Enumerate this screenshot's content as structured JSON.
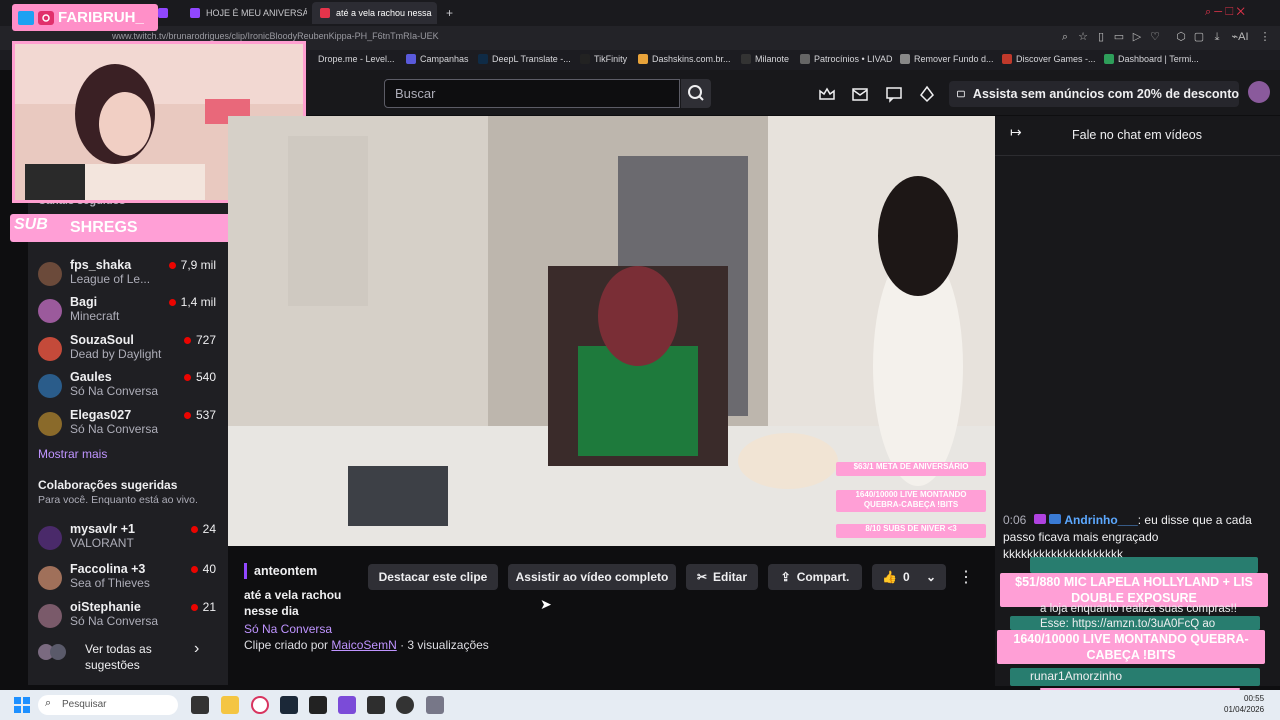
{
  "browser": {
    "tabs": [
      {
        "label": "",
        "icon": "twitch-tab-icon"
      },
      {
        "label": "HOJE É MEU ANIVERSÁRIO",
        "icon": "twitch-tab-icon"
      },
      {
        "label": "até a vela rachou nessa",
        "icon": "twitch-tab-icon",
        "active": true
      }
    ],
    "new_tab_label": "+",
    "url": "www.twitch.tv/brunarodrigues/clip/IronicBloodyReubenKippa-PH_F6tnTmRIa-UEK",
    "bookmarks": [
      {
        "label": "Drope.me - Level..."
      },
      {
        "label": "Campanhas"
      },
      {
        "label": "DeepL Translate -..."
      },
      {
        "label": "TikFinity"
      },
      {
        "label": "Dashskins.com.br..."
      },
      {
        "label": "Milanote"
      },
      {
        "label": "Patrocínios • LIVAD"
      },
      {
        "label": "Remover Fundo d..."
      },
      {
        "label": "Discover Games -..."
      },
      {
        "label": "Dashboard | Termi..."
      }
    ]
  },
  "overlay": {
    "brand": "FARIBRUH_",
    "sub_label": "SUB",
    "sub_name": "SHREGS"
  },
  "topnav": {
    "search_placeholder": "Buscar",
    "promo": "Assista sem anúncios com 20% de desconto"
  },
  "sidebar": {
    "section_partial": "Canais seguidos",
    "channels": [
      {
        "name": "fps_shaka",
        "game": "League of Le...",
        "viewers": "7,9 mil",
        "color": "#6b4a3a"
      },
      {
        "name": "Bagi",
        "game": "Minecraft",
        "viewers": "1,4 mil",
        "color": "#9b5a9c"
      },
      {
        "name": "SouzaSoul",
        "game": "Dead by Daylight",
        "viewers": "727",
        "color": "#c44a3a"
      },
      {
        "name": "Gaules",
        "game": "Só Na Conversa",
        "viewers": "540",
        "color": "#2a5c8a"
      },
      {
        "name": "Elegas027",
        "game": "Só Na Conversa",
        "viewers": "537",
        "color": "#8a6a2a"
      }
    ],
    "show_more": "Mostrar mais",
    "collab_title": "Colaborações sugeridas",
    "collab_sub": "Para você. Enquanto está ao vivo.",
    "collabs": [
      {
        "name": "mysavlr +1",
        "game": "VALORANT",
        "viewers": "24",
        "color": "#4a2a6a"
      },
      {
        "name": "Faccolina +3",
        "game": "Sea of Thieves",
        "viewers": "40",
        "color": "#a0705a"
      },
      {
        "name": "oiStephanie",
        "game": "Só Na Conversa",
        "viewers": "21",
        "color": "#7a5a6a"
      }
    ],
    "see_all": "Ver todas as sugestões"
  },
  "video": {
    "goal_lines": [
      "$63/1 META DE ANIVERSÁRIO",
      "1640/10000 LIVE MONTANDO QUEBRA-CABEÇA !BITS",
      "8/10 SUBS DE NIVER <3"
    ]
  },
  "clip": {
    "when": "anteontem",
    "title": "até a vela rachou nesse dia",
    "category": "Só Na Conversa",
    "creator_prefix": "Clipe criado por",
    "creator": "MaicoSemN",
    "views": "· 3 visualizações",
    "buttons": {
      "feature": "Destacar este clipe",
      "watch_full": "Assistir ao vídeo completo",
      "edit": "Editar",
      "share": "Compart.",
      "likes": "0"
    }
  },
  "chat": {
    "title": "Fale no chat em vídeos",
    "message": {
      "time": "0:06",
      "user": "Andrinho___",
      "text": ": eu disse que a cada passo ficava mais engraçado kkkkkkkkkkkkkkkkkkkk"
    },
    "overlay_lines": [
      "$51/880 MIC LAPELA HOLLYLAND + LIS DOUBLE EXPOSURE",
      "1640/10000 LIVE MONTANDO QUEBRA-CABEÇA !BITS",
      "1/10 SUBS DO DIA <3"
    ],
    "faded_1": "a loja enquanto realiza suas compras!!",
    "faded_2": "Esse: https://amzn.to/3uA0FcQ ao",
    "faded_3": "runar1Amorzinho"
  },
  "taskbar": {
    "search": "Pesquisar",
    "time": "00:55",
    "date": "01/04/2026"
  }
}
